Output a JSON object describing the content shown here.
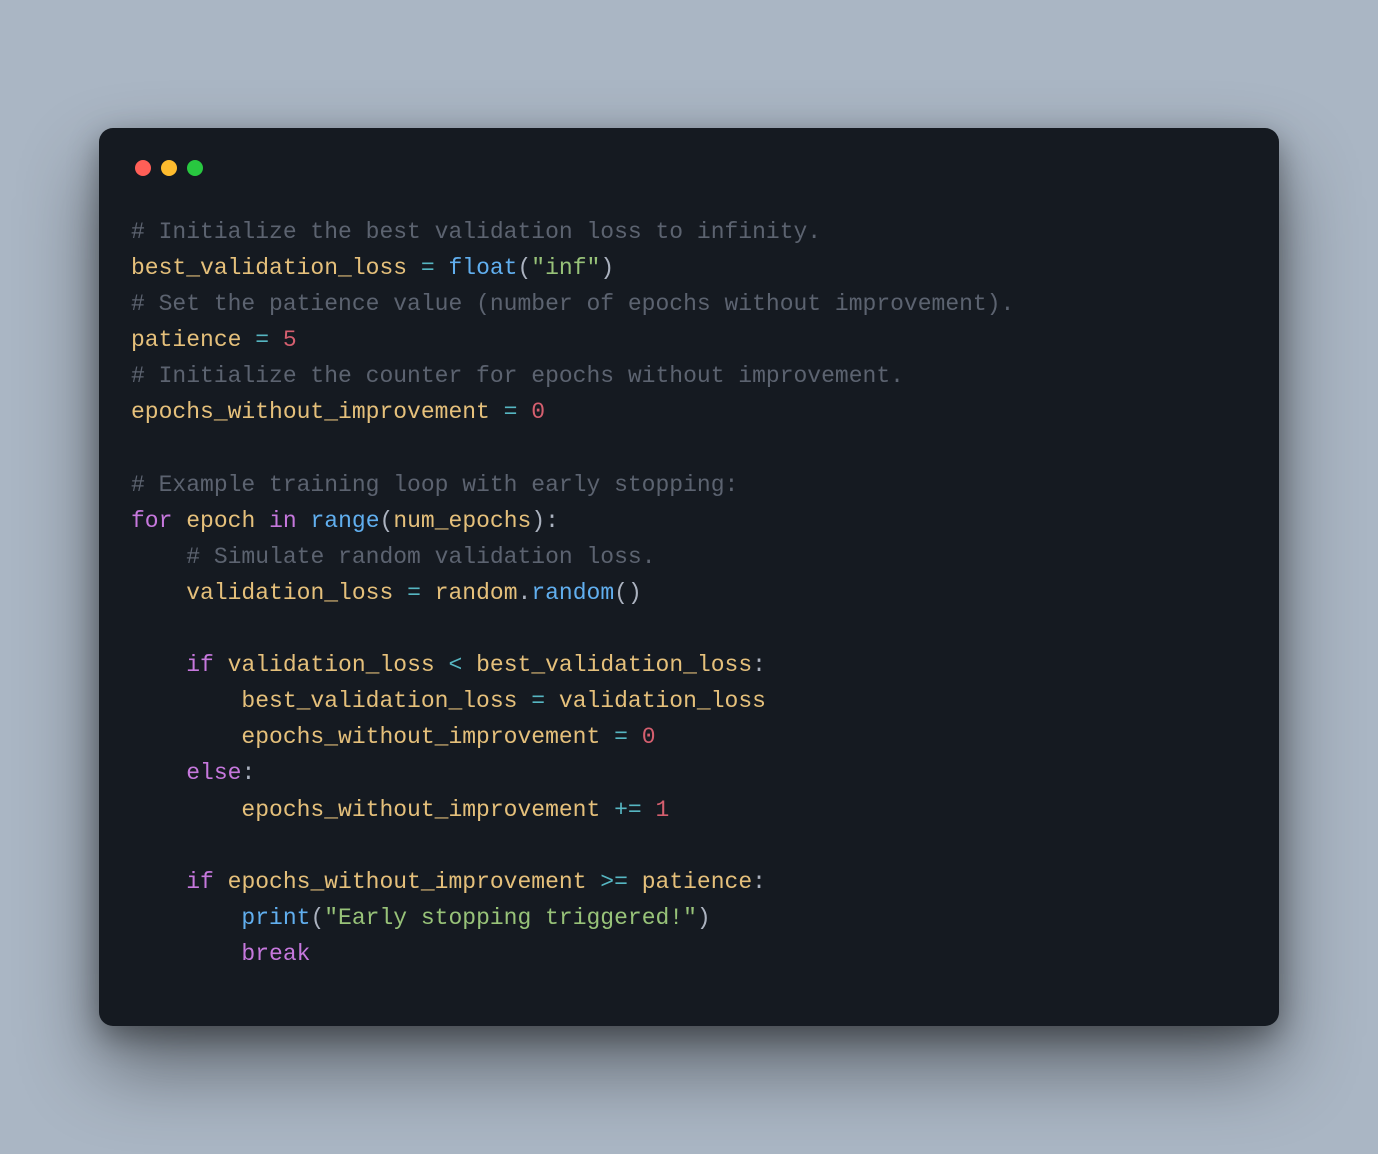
{
  "window": {
    "traffic_lights": [
      "red",
      "yellow",
      "green"
    ]
  },
  "code": {
    "l01_comment": "# Initialize the best validation loss to infinity.",
    "l02_var": "best_validation_loss",
    "l02_eq": " = ",
    "l02_float": "float",
    "l02_paren_open": "(",
    "l02_str": "\"inf\"",
    "l02_paren_close": ")",
    "l03_comment": "# Set the patience value (number of epochs without improvement).",
    "l04_var": "patience",
    "l04_eq": " = ",
    "l04_num": "5",
    "l05_comment": "# Initialize the counter for epochs without improvement.",
    "l06_var": "epochs_without_improvement",
    "l06_eq": " = ",
    "l06_num": "0",
    "l08_comment": "# Example training loop with early stopping:",
    "l09_for": "for",
    "l09_sp1": " ",
    "l09_epoch": "epoch",
    "l09_sp2": " ",
    "l09_in": "in",
    "l09_sp3": " ",
    "l09_range": "range",
    "l09_po": "(",
    "l09_numep": "num_epochs",
    "l09_pc": "):",
    "l10_indent": "    ",
    "l10_comment": "# Simulate random validation loss.",
    "l11_indent": "    ",
    "l11_vl": "validation_loss",
    "l11_eq": " = ",
    "l11_random_mod": "random",
    "l11_dot": ".",
    "l11_random_fn": "random",
    "l11_parens": "()",
    "l13_indent": "    ",
    "l13_if": "if",
    "l13_sp": " ",
    "l13_vl": "validation_loss",
    "l13_lt": " < ",
    "l13_bvl": "best_validation_loss",
    "l13_colon": ":",
    "l14_indent": "        ",
    "l14_bvl": "best_validation_loss",
    "l14_eq": " = ",
    "l14_vl": "validation_loss",
    "l15_indent": "        ",
    "l15_ewi": "epochs_without_improvement",
    "l15_eq": " = ",
    "l15_num": "0",
    "l16_indent": "    ",
    "l16_else": "else",
    "l16_colon": ":",
    "l17_indent": "        ",
    "l17_ewi": "epochs_without_improvement",
    "l17_pluseq": " += ",
    "l17_num": "1",
    "l19_indent": "    ",
    "l19_if": "if",
    "l19_sp": " ",
    "l19_ewi": "epochs_without_improvement",
    "l19_ge": " >= ",
    "l19_pat": "patience",
    "l19_colon": ":",
    "l20_indent": "        ",
    "l20_print": "print",
    "l20_po": "(",
    "l20_str": "\"Early stopping triggered!\"",
    "l20_pc": ")",
    "l21_indent": "        ",
    "l21_break": "break"
  }
}
